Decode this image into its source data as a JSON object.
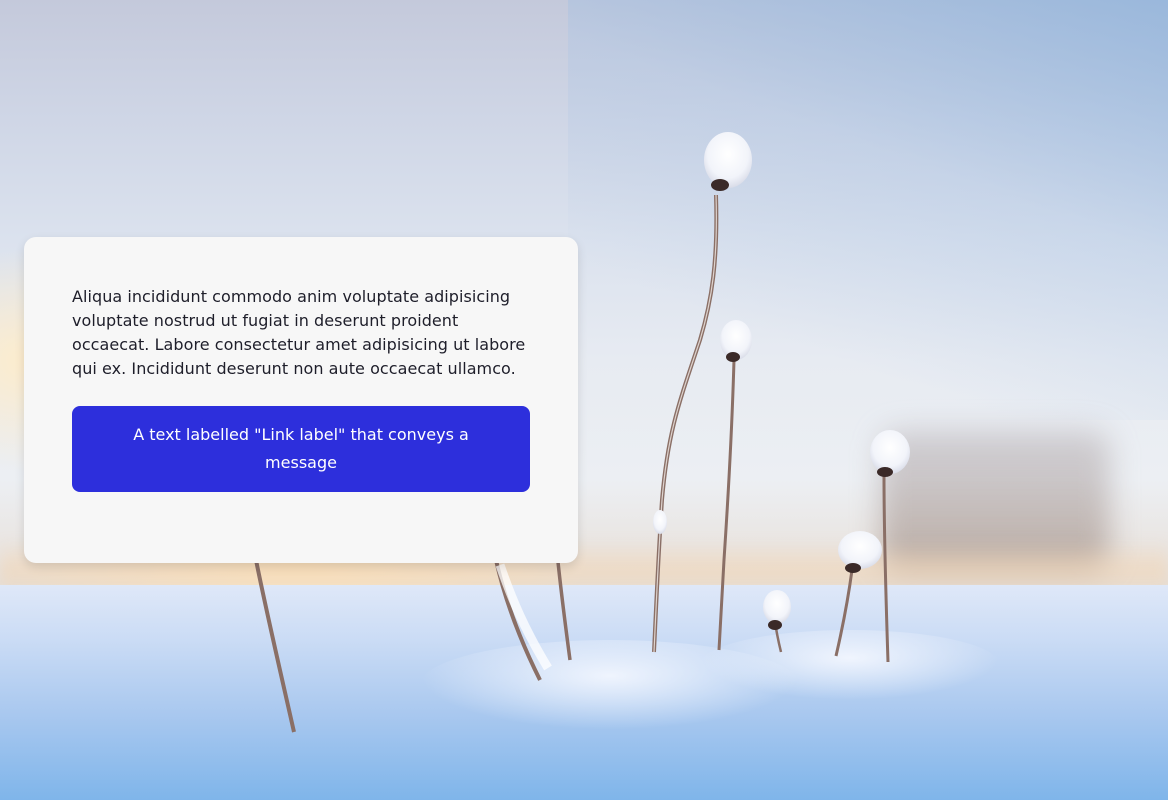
{
  "card": {
    "body_text": "Aliqua incididunt commodo anim voluptate adipisicing voluptate nostrud ut fugiat in deserunt proident occaecat. Labore consectetur amet adipisicing ut labore qui ex. Incididunt deserunt non aute occaecat ullamco.",
    "button_label": "A text labelled \"Link label\" that conveys a message"
  },
  "colors": {
    "button_background": "#2d2fdc",
    "card_background": "#f7f7f7",
    "text": "#1e1e2a"
  }
}
